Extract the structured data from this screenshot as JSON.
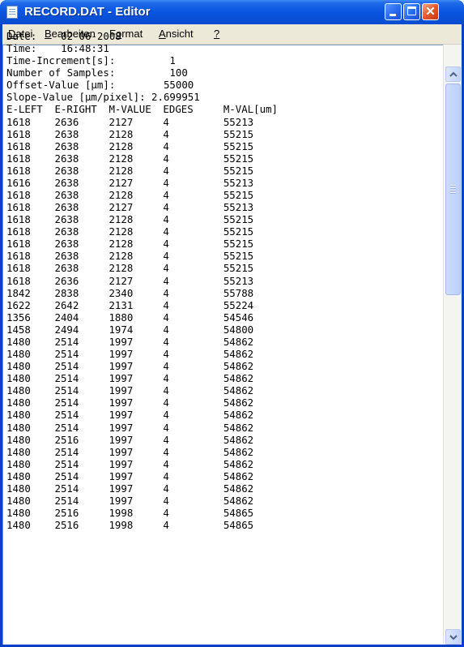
{
  "window": {
    "title": "RECORD.DAT - Editor"
  },
  "menu": [
    {
      "before": "",
      "accel": "D",
      "after": "atei"
    },
    {
      "before": "",
      "accel": "B",
      "after": "earbeiten"
    },
    {
      "before": "F",
      "accel": "o",
      "after": "rmat"
    },
    {
      "before": "",
      "accel": "A",
      "after": "nsicht"
    },
    {
      "before": "",
      "accel": "?",
      "after": ""
    }
  ],
  "header_lines": [
    "Date:    02-06-2008",
    "Time:    16:48:31",
    "Time-Increment[s]:         1",
    "Number of Samples:         100",
    "Offset-Value [µm]:        55000",
    "Slope-Value [µm/pixel]: 2.699951"
  ],
  "columns": [
    "E-LEFT",
    "E-RIGHT",
    "M-VALUE",
    "EDGES",
    "M-VAL[um]"
  ],
  "rows": [
    [
      "1618",
      "2636",
      "2127",
      "4",
      "55213"
    ],
    [
      "1618",
      "2638",
      "2128",
      "4",
      "55215"
    ],
    [
      "1618",
      "2638",
      "2128",
      "4",
      "55215"
    ],
    [
      "1618",
      "2638",
      "2128",
      "4",
      "55215"
    ],
    [
      "1618",
      "2638",
      "2128",
      "4",
      "55215"
    ],
    [
      "1616",
      "2638",
      "2127",
      "4",
      "55213"
    ],
    [
      "1618",
      "2638",
      "2128",
      "4",
      "55215"
    ],
    [
      "1618",
      "2638",
      "2127",
      "4",
      "55213"
    ],
    [
      "1618",
      "2638",
      "2128",
      "4",
      "55215"
    ],
    [
      "1618",
      "2638",
      "2128",
      "4",
      "55215"
    ],
    [
      "1618",
      "2638",
      "2128",
      "4",
      "55215"
    ],
    [
      "1618",
      "2638",
      "2128",
      "4",
      "55215"
    ],
    [
      "1618",
      "2638",
      "2128",
      "4",
      "55215"
    ],
    [
      "1618",
      "2636",
      "2127",
      "4",
      "55213"
    ],
    [
      "1842",
      "2838",
      "2340",
      "4",
      "55788"
    ],
    [
      "1622",
      "2642",
      "2131",
      "4",
      "55224"
    ],
    [
      "1356",
      "2404",
      "1880",
      "4",
      "54546"
    ],
    [
      "1458",
      "2494",
      "1974",
      "4",
      "54800"
    ],
    [
      "1480",
      "2514",
      "1997",
      "4",
      "54862"
    ],
    [
      "1480",
      "2514",
      "1997",
      "4",
      "54862"
    ],
    [
      "1480",
      "2514",
      "1997",
      "4",
      "54862"
    ],
    [
      "1480",
      "2514",
      "1997",
      "4",
      "54862"
    ],
    [
      "1480",
      "2514",
      "1997",
      "4",
      "54862"
    ],
    [
      "1480",
      "2514",
      "1997",
      "4",
      "54862"
    ],
    [
      "1480",
      "2514",
      "1997",
      "4",
      "54862"
    ],
    [
      "1480",
      "2514",
      "1997",
      "4",
      "54862"
    ],
    [
      "1480",
      "2516",
      "1997",
      "4",
      "54862"
    ],
    [
      "1480",
      "2514",
      "1997",
      "4",
      "54862"
    ],
    [
      "1480",
      "2514",
      "1997",
      "4",
      "54862"
    ],
    [
      "1480",
      "2514",
      "1997",
      "4",
      "54862"
    ],
    [
      "1480",
      "2514",
      "1997",
      "4",
      "54862"
    ],
    [
      "1480",
      "2514",
      "1997",
      "4",
      "54862"
    ],
    [
      "1480",
      "2516",
      "1998",
      "4",
      "54865"
    ],
    [
      "1480",
      "2516",
      "1998",
      "4",
      "54865"
    ]
  ],
  "icons": {
    "app": "notepad-icon",
    "minimize": "minimize-icon",
    "maximize": "maximize-icon",
    "close": "close-icon",
    "scroll_up": "chevron-up-icon",
    "scroll_down": "chevron-down-icon"
  },
  "colors": {
    "titlebar": "#0a57e2",
    "menubar": "#ece9d8",
    "close_button": "#e25a2b"
  }
}
